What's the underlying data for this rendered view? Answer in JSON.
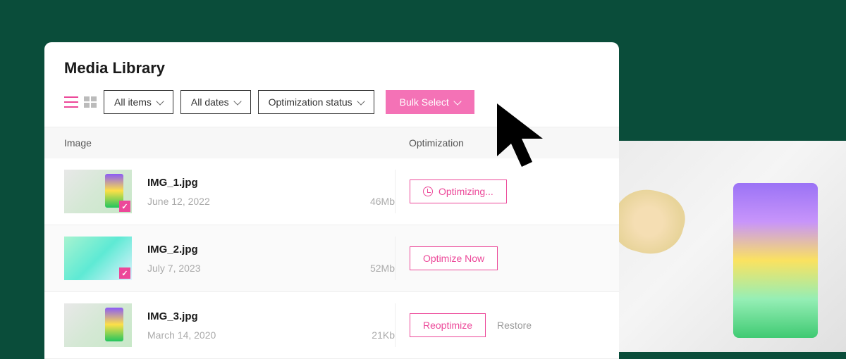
{
  "header": {
    "title": "Media Library"
  },
  "toolbar": {
    "filters": {
      "items": "All items",
      "dates": "All dates",
      "optimization": "Optimization status"
    },
    "bulk_select": "Bulk Select"
  },
  "columns": {
    "image": "Image",
    "optimization": "Optimization"
  },
  "actions": {
    "optimizing": "Optimizing...",
    "optimize_now": "Optimize Now",
    "reoptimize": "Reoptimize",
    "restore": "Restore"
  },
  "rows": [
    {
      "filename": "IMG_1.jpg",
      "date": "June 12, 2022",
      "size": "46Mb",
      "status": "optimizing"
    },
    {
      "filename": "IMG_2.jpg",
      "date": "July 7, 2023",
      "size": "52Mb",
      "status": "optimize_now"
    },
    {
      "filename": "IMG_3.jpg",
      "date": "March 14, 2020",
      "size": "21Kb",
      "status": "reoptimize"
    }
  ]
}
